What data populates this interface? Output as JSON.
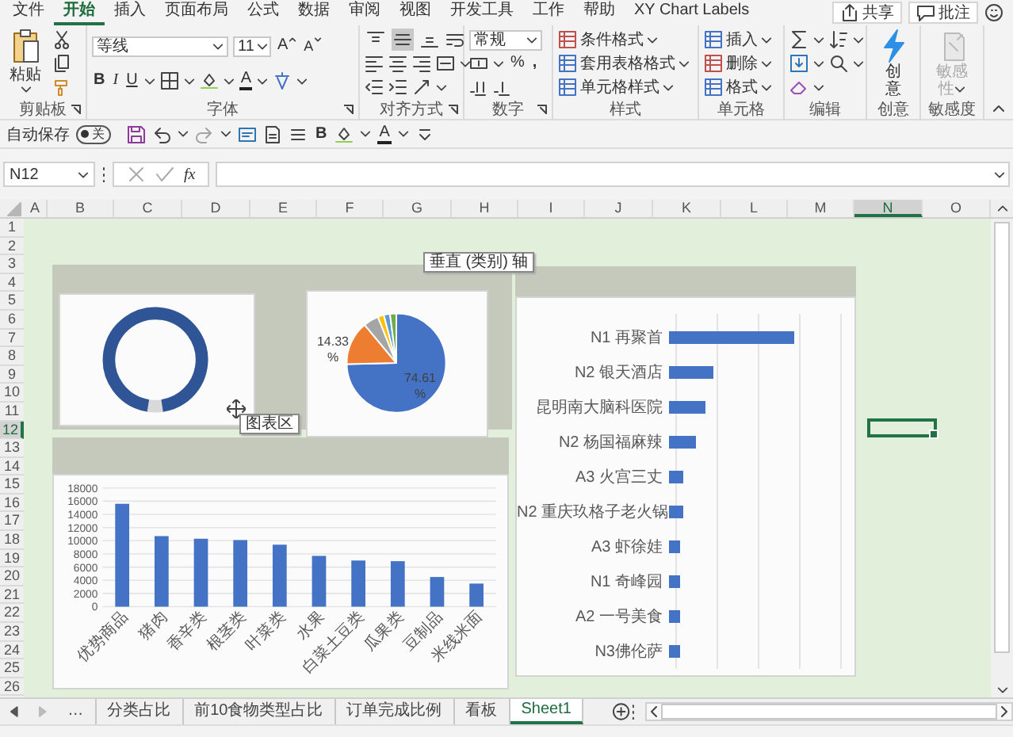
{
  "ribbon_tabs": [
    {
      "label": "文件",
      "selected": false
    },
    {
      "label": "开始",
      "selected": true
    },
    {
      "label": "插入",
      "selected": false
    },
    {
      "label": "页面布局",
      "selected": false
    },
    {
      "label": "公式",
      "selected": false
    },
    {
      "label": "数据",
      "selected": false
    },
    {
      "label": "审阅",
      "selected": false
    },
    {
      "label": "视图",
      "selected": false
    },
    {
      "label": "开发工具",
      "selected": false
    },
    {
      "label": "工作",
      "selected": false
    },
    {
      "label": "帮助",
      "selected": false
    },
    {
      "label": "XY Chart Labels",
      "selected": false
    }
  ],
  "share_button": "共享",
  "comment_button": "批注",
  "clipboard": {
    "paste": "粘贴",
    "label": "剪贴板"
  },
  "font": {
    "name": "等线",
    "size": "11",
    "grow": "A",
    "shrink": "A",
    "bold": "B",
    "italic": "I",
    "underline": "U",
    "font_color_button": "A",
    "label": "字体"
  },
  "alignment": {
    "vertical": [
      {
        "selected": false
      },
      {
        "selected": true
      },
      {
        "selected": false
      }
    ],
    "label": "对齐方式"
  },
  "number": {
    "format": "常规",
    "percent": "%",
    "comma": ",",
    "label": "数字"
  },
  "styles": {
    "buttons": [
      "条件格式",
      "套用表格格式",
      "单元格样式"
    ],
    "label": "样式"
  },
  "cells": {
    "buttons": [
      "插入",
      "删除",
      "格式"
    ],
    "label": "单元格"
  },
  "editing": {
    "label": "编辑"
  },
  "ideas": {
    "button": "创意",
    "label": "创意"
  },
  "sensitivity": {
    "button": "敏感性",
    "disabled": true,
    "label": "敏感度"
  },
  "quick_access": {
    "autosave": "自动保存",
    "toggle": {
      "label": "关",
      "on": false
    },
    "bold": "B",
    "font_color_button": "A"
  },
  "formula_bar": {
    "name_box": "N12",
    "fx": "fx"
  },
  "columns": [
    {
      "label": "A",
      "selected": false
    },
    {
      "label": "B",
      "selected": false
    },
    {
      "label": "C",
      "selected": false
    },
    {
      "label": "D",
      "selected": false
    },
    {
      "label": "E",
      "selected": false
    },
    {
      "label": "F",
      "selected": false
    },
    {
      "label": "G",
      "selected": false
    },
    {
      "label": "H",
      "selected": false
    },
    {
      "label": "I",
      "selected": false
    },
    {
      "label": "J",
      "selected": false
    },
    {
      "label": "K",
      "selected": false
    },
    {
      "label": "L",
      "selected": false
    },
    {
      "label": "M",
      "selected": false
    },
    {
      "label": "N",
      "selected": true
    },
    {
      "label": "O",
      "selected": false
    }
  ],
  "rows": [
    {
      "label": "1",
      "selected": false
    },
    {
      "label": "2",
      "selected": false
    },
    {
      "label": "3",
      "selected": false
    },
    {
      "label": "4",
      "selected": false
    },
    {
      "label": "5",
      "selected": false
    },
    {
      "label": "6",
      "selected": false
    },
    {
      "label": "7",
      "selected": false
    },
    {
      "label": "8",
      "selected": false
    },
    {
      "label": "9",
      "selected": false
    },
    {
      "label": "10",
      "selected": false
    },
    {
      "label": "11",
      "selected": false
    },
    {
      "label": "12",
      "selected": true
    },
    {
      "label": "13",
      "selected": false
    },
    {
      "label": "14",
      "selected": false
    },
    {
      "label": "15",
      "selected": false
    },
    {
      "label": "16",
      "selected": false
    },
    {
      "label": "17",
      "selected": false
    },
    {
      "label": "18",
      "selected": false
    },
    {
      "label": "19",
      "selected": false
    },
    {
      "label": "20",
      "selected": false
    },
    {
      "label": "21",
      "selected": false
    },
    {
      "label": "22",
      "selected": false
    },
    {
      "label": "23",
      "selected": false
    },
    {
      "label": "24",
      "selected": false
    },
    {
      "label": "25",
      "selected": false
    },
    {
      "label": "26",
      "selected": false
    }
  ],
  "tooltips": {
    "axis": "垂直 (类别) 轴",
    "chart_area": "图表区"
  },
  "pie_labels": [
    "14.33 %",
    "74.61 %"
  ],
  "column_chart": {
    "chart_data": {
      "type": "bar",
      "categories": [
        "优势商品",
        "猪肉",
        "香辛类",
        "根茎类",
        "叶菜类",
        "水果",
        "白菜土豆类",
        "瓜果类",
        "豆制品",
        "米线米面"
      ],
      "values": [
        15600,
        10700,
        10300,
        10100,
        9400,
        7700,
        7000,
        6900,
        4500,
        3500
      ],
      "ylim": [
        0,
        18000
      ],
      "yticks": [
        0,
        2000,
        4000,
        6000,
        8000,
        10000,
        12000,
        14000,
        16000,
        18000
      ],
      "grid": true
    }
  },
  "ranking_chart": {
    "labels": [
      "N1 再聚首",
      "N2 银天酒店",
      "昆明南大脑科医院",
      "N2 杨国福麻辣",
      "A3 火宫三丈",
      "N2 重庆玖格子老火锅",
      "A3 虾徐娃",
      "N1 奇峰园",
      "A2 一号美食",
      "N3佛伦萨"
    ]
  },
  "sheet_nav": "…",
  "sheet_tabs": [
    {
      "label": "分类占比",
      "selected": false
    },
    {
      "label": "前10食物类型占比",
      "selected": false
    },
    {
      "label": "订单完成比例",
      "selected": false
    },
    {
      "label": "看板",
      "selected": false
    },
    {
      "label": "Sheet1",
      "selected": true
    }
  ]
}
